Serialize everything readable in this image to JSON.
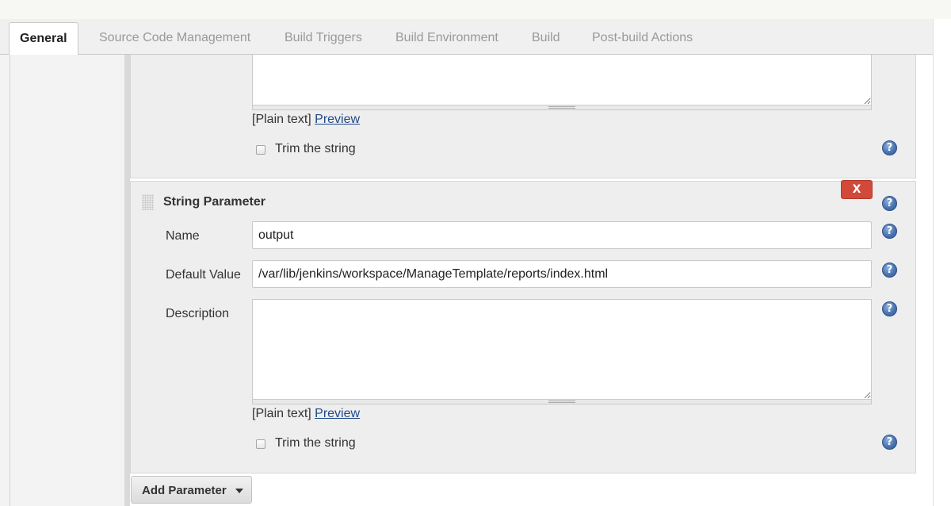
{
  "tabs": [
    {
      "label": "General",
      "active": true
    },
    {
      "label": "Source Code Management",
      "active": false
    },
    {
      "label": "Build Triggers",
      "active": false
    },
    {
      "label": "Build Environment",
      "active": false
    },
    {
      "label": "Build",
      "active": false
    },
    {
      "label": "Post-build Actions",
      "active": false
    }
  ],
  "prev_param": {
    "format_text": "[Plain text]",
    "preview_link": "Preview",
    "trim_label": "Trim the string",
    "trim_checked": false
  },
  "string_param": {
    "title": "String Parameter",
    "delete_label": "X",
    "name_label": "Name",
    "name_value": "output",
    "default_label": "Default Value",
    "default_value": "/var/lib/jenkins/workspace/ManageTemplate/reports/index.html",
    "description_label": "Description",
    "description_value": "",
    "format_text": "[Plain text]",
    "preview_link": "Preview",
    "trim_label": "Trim the string",
    "trim_checked": false
  },
  "help_glyph": "?",
  "add_parameter_label": "Add Parameter",
  "icons": [
    "help-icon",
    "drag-handle-icon",
    "dropdown-caret-icon",
    "resize-grip-icon"
  ],
  "colors": {
    "delete_button": "#d24939",
    "link": "#204a87",
    "help_icon": "#4a74b3"
  }
}
